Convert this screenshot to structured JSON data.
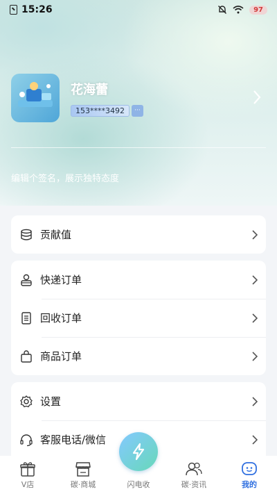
{
  "status_bar": {
    "time": "15:26",
    "battery": "97"
  },
  "profile": {
    "name": "花海蕾",
    "phone": "153****3492",
    "edit": "···"
  },
  "signature": "编辑个签名，展示独特态度",
  "menu": {
    "contribution": "贡献值",
    "express_orders": "快递订单",
    "recycle_orders": "回收订单",
    "goods_orders": "商品订单",
    "settings": "设置",
    "customer_service": "客服电话/微信"
  },
  "tabs": {
    "vstore": "V店",
    "mall": "碳·商城",
    "flash": "闪电收",
    "news": "碳·资讯",
    "mine": "我的"
  },
  "colors": {
    "accent": "#2f6fe0"
  }
}
